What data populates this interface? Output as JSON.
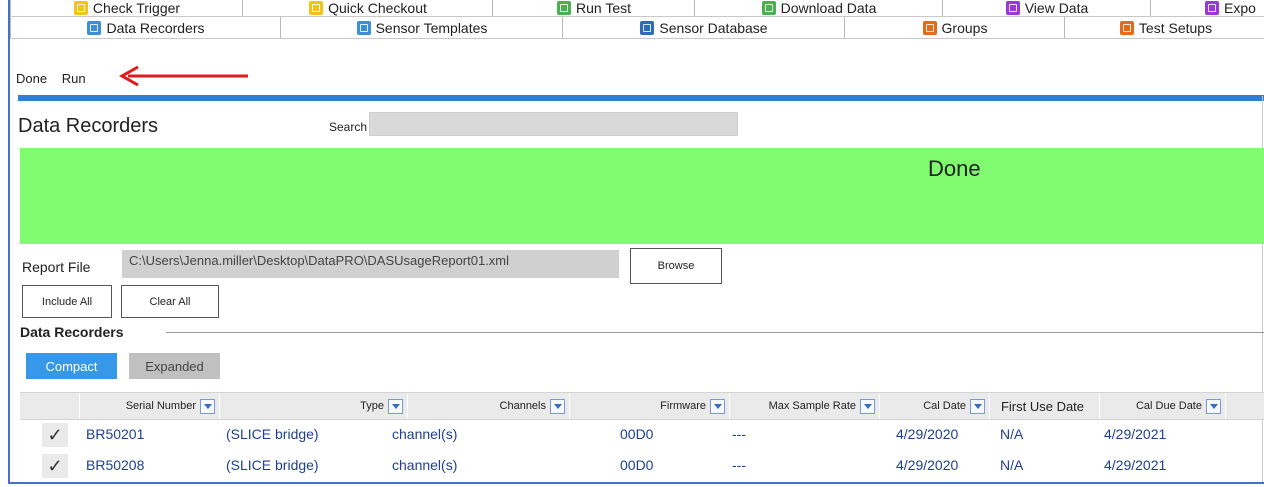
{
  "tabs_row1": [
    {
      "label": "Check Trigger",
      "icon": "trigger-icon"
    },
    {
      "label": "Quick Checkout",
      "icon": "checkout-icon"
    },
    {
      "label": "Run Test",
      "icon": "run-test-icon"
    },
    {
      "label": "Download Data",
      "icon": "download-icon"
    },
    {
      "label": "View Data",
      "icon": "view-data-icon"
    },
    {
      "label": "Expo",
      "icon": "export-icon"
    }
  ],
  "tabs_row2": [
    {
      "label": "Data Recorders",
      "icon": "data-recorders-icon"
    },
    {
      "label": "Sensor Templates",
      "icon": "sensor-templates-icon"
    },
    {
      "label": "Sensor Database",
      "icon": "sensor-database-icon"
    },
    {
      "label": "Groups",
      "icon": "groups-icon"
    },
    {
      "label": "Test Setups",
      "icon": "test-setups-icon"
    }
  ],
  "menu": {
    "done": "Done",
    "run": "Run"
  },
  "page": {
    "title": "Data Recorders",
    "search_label": "Search",
    "search_value": ""
  },
  "banner": {
    "text": "Done",
    "color": "#80fa6e"
  },
  "report": {
    "label": "Report File",
    "path": "C:\\Users\\Jenna.miller\\Desktop\\DataPRO\\DASUsageReport01.xml",
    "browse": "Browse"
  },
  "actions": {
    "include_all": "Include All",
    "clear_all": "Clear All"
  },
  "section": {
    "title": "Data Recorders"
  },
  "view": {
    "compact": "Compact",
    "expanded": "Expanded",
    "active": "Compact"
  },
  "columns": [
    "Serial Number",
    "Type",
    "Channels",
    "Firmware",
    "Max Sample Rate",
    "Cal Date",
    "First Use Date",
    "Cal Due Date"
  ],
  "rows": [
    {
      "checked": "✓",
      "serial": "BR50201",
      "type": "(SLICE bridge)",
      "channels": "channel(s)",
      "firmware": "00D0",
      "max_rate": "---",
      "cal_date": "4/29/2020",
      "first_use": "N/A",
      "cal_due": "4/29/2021"
    },
    {
      "checked": "✓",
      "serial": "BR50208",
      "type": "(SLICE bridge)",
      "channels": "channel(s)",
      "firmware": "00D0",
      "max_rate": "---",
      "cal_date": "4/29/2020",
      "first_use": "N/A",
      "cal_due": "4/29/2021"
    }
  ],
  "colors": {
    "accent": "#2f7fd6",
    "banner": "#80fa6e",
    "link": "#1f3f8f",
    "arrow": "#e01b1b"
  }
}
